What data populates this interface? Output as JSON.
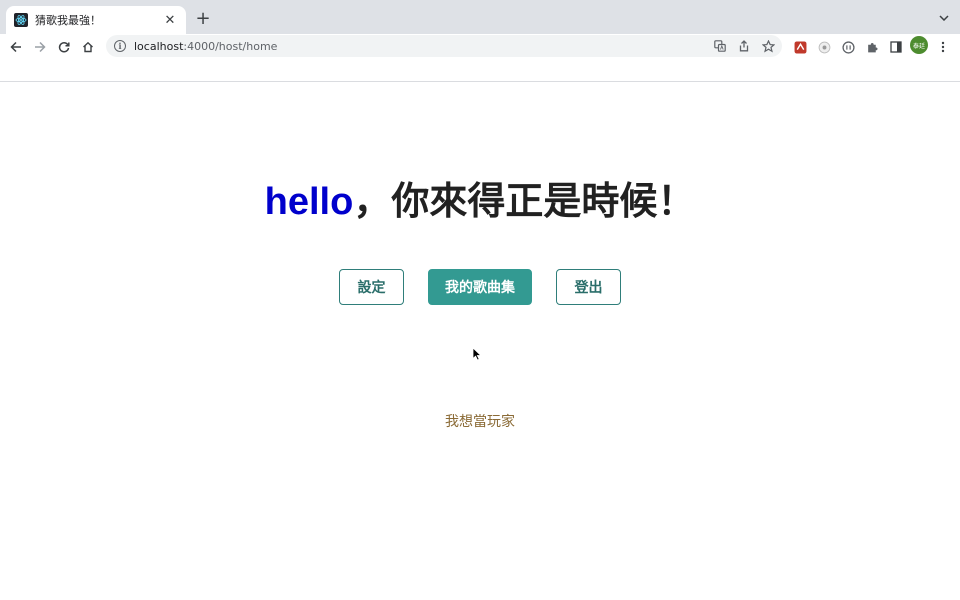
{
  "browser": {
    "tab": {
      "title": "猜歌我最強！",
      "close": "✕"
    },
    "new_tab": "+",
    "url": {
      "host": "localhost",
      "path": ":4000/host/home"
    },
    "profile_initials": "泰廷",
    "colors": {
      "tabstrip": "#dee1e6",
      "toolbar": "#ffffff",
      "omnibox": "#f1f3f4"
    }
  },
  "page": {
    "greeting": {
      "name": "hello",
      "message": "，你來得正是時候！"
    },
    "buttons": {
      "settings": "設定",
      "my_songs": "我的歌曲集",
      "logout": "登出"
    },
    "player_link": "我想當玩家",
    "colors": {
      "name": "#0000cc",
      "text": "#212121",
      "teal": "#339a92",
      "link": "#8a6a35"
    }
  }
}
